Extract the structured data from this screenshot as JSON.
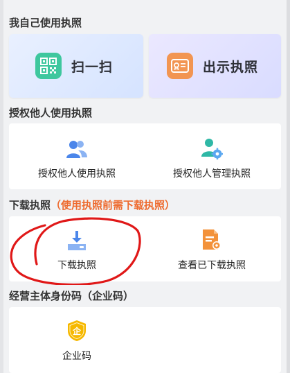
{
  "sections": {
    "self_title": "我自己使用执照",
    "delegate_title": "授权他人使用执照",
    "download_title": "下载执照",
    "download_note": "（使用执照前需下载执照）",
    "identity_title": "经营主体身份码（企业码）"
  },
  "self_actions": {
    "scan_label": "扫一扫",
    "scan_icon": "qr-code-icon",
    "show_label": "出示执照",
    "show_icon": "license-card-icon"
  },
  "delegate_actions": {
    "use_label": "授权他人使用执照",
    "use_icon": "users-icon",
    "manage_label": "授权他人管理执照",
    "manage_icon": "user-gear-icon"
  },
  "download_actions": {
    "download_label": "下载执照",
    "download_icon": "download-tray-icon",
    "view_label": "查看已下载执照",
    "view_icon": "document-view-icon"
  },
  "identity_actions": {
    "code_label": "企业码",
    "code_icon": "shield-qi-icon",
    "code_glyph": "企"
  },
  "colors": {
    "accent_note": "#ee6a2e",
    "scan_green": "#3ec79e",
    "show_orange": "#f29552",
    "icon_blue": "#4b86ea",
    "icon_teal": "#2fb8a6",
    "icon_orange": "#f3923a",
    "shield_yellow": "#f6b800",
    "hand_drawn_circle": "#e01818"
  }
}
